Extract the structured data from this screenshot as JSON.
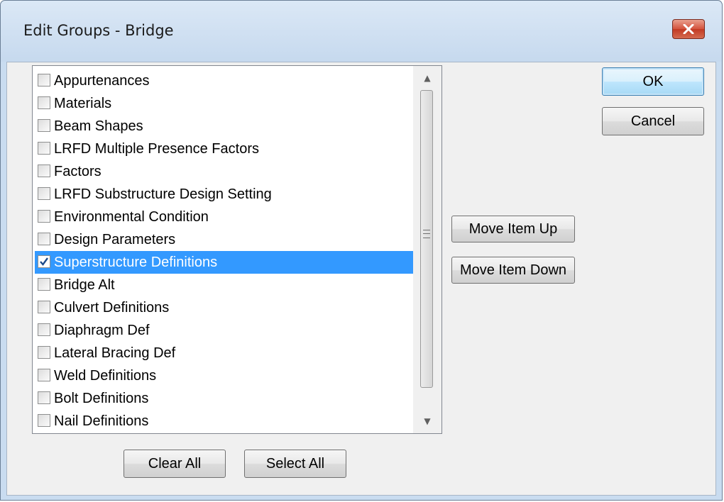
{
  "window": {
    "title": "Edit Groups - Bridge"
  },
  "list": {
    "items": [
      {
        "label": "Appurtenances",
        "checked": false,
        "selected": false
      },
      {
        "label": "Materials",
        "checked": false,
        "selected": false
      },
      {
        "label": "Beam Shapes",
        "checked": false,
        "selected": false
      },
      {
        "label": "LRFD Multiple Presence Factors",
        "checked": false,
        "selected": false
      },
      {
        "label": "Factors",
        "checked": false,
        "selected": false
      },
      {
        "label": "LRFD Substructure Design Setting",
        "checked": false,
        "selected": false
      },
      {
        "label": "Environmental Condition",
        "checked": false,
        "selected": false
      },
      {
        "label": "Design Parameters",
        "checked": false,
        "selected": false
      },
      {
        "label": "Superstructure Definitions",
        "checked": true,
        "selected": true
      },
      {
        "label": "Bridge Alt",
        "checked": false,
        "selected": false
      },
      {
        "label": "Culvert Definitions",
        "checked": false,
        "selected": false
      },
      {
        "label": "Diaphragm Def",
        "checked": false,
        "selected": false
      },
      {
        "label": "Lateral Bracing Def",
        "checked": false,
        "selected": false
      },
      {
        "label": "Weld Definitions",
        "checked": false,
        "selected": false
      },
      {
        "label": "Bolt Definitions",
        "checked": false,
        "selected": false
      },
      {
        "label": "Nail Definitions",
        "checked": false,
        "selected": false
      }
    ]
  },
  "buttons": {
    "ok": "OK",
    "cancel": "Cancel",
    "move_up": "Move Item Up",
    "move_down": "Move Item Down",
    "clear_all": "Clear All",
    "select_all": "Select All"
  },
  "icons": {
    "close": "close-icon",
    "checkmark": "checkmark-icon",
    "scroll_up": "scroll-up-arrow-icon",
    "scroll_down": "scroll-down-arrow-icon",
    "scroll_grip": "scroll-grip-icon"
  },
  "colors": {
    "selection": "#3399ff",
    "close_button": "#c23a23",
    "titlebar": "#c9dcf0"
  }
}
